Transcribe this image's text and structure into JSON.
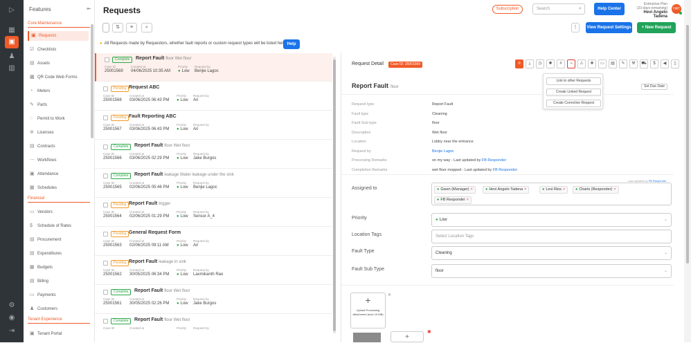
{
  "colors": {
    "accent": "#f05a28",
    "primary": "#1a73e8",
    "success": "#21a35a"
  },
  "sidebar": {
    "header": "Features",
    "collapse_icon": "collapse-icon",
    "groups": [
      {
        "label": "Core Maintenance"
      },
      {
        "label": "Financial"
      },
      {
        "label": "Tenant Experience"
      }
    ],
    "items": [
      {
        "label": "Requests"
      },
      {
        "label": "Checklists"
      },
      {
        "label": "Assets"
      },
      {
        "label": "QR Code Web Forms"
      },
      {
        "label": "Meters"
      },
      {
        "label": "Parts"
      },
      {
        "label": "Permit to Work"
      },
      {
        "label": "Licenses"
      },
      {
        "label": "Contracts"
      },
      {
        "label": "Workflows"
      },
      {
        "label": "Attendance"
      },
      {
        "label": "Schedules"
      },
      {
        "label": "Vendors"
      },
      {
        "label": "Schedule of Rates"
      },
      {
        "label": "Procurement"
      },
      {
        "label": "Expenditures"
      },
      {
        "label": "Budgets"
      },
      {
        "label": "Billing"
      },
      {
        "label": "Payments"
      },
      {
        "label": "Customers"
      },
      {
        "label": "Tenant Portal"
      }
    ]
  },
  "header": {
    "title": "Requests",
    "subscription": "Subscription",
    "search_placeholder": "Search",
    "help_center": "Help Center",
    "plan": "Enterprise Plan",
    "remaining": "(23 days remaining)",
    "user_name": "Hevi Angelo Tadena",
    "initials": "HAT"
  },
  "toolbar": {
    "view_settings": "View Request Settings",
    "new_request": "+ New Request",
    "kebab": "⋮"
  },
  "info": {
    "text": "All Requests made by Requestors, whether fault reports or custom request types will be listed here.",
    "help": "Help"
  },
  "list_labels": {
    "case": "Case ID",
    "created": "Created at",
    "priority": "Priority",
    "requested": "Request by"
  },
  "requests": [
    {
      "status": "Complete",
      "title": "Report Fault",
      "sub": "floor Wet floor",
      "case": "25001569",
      "created": "04/06/2025 10:35 AM",
      "priority": "Low",
      "by": "Benjie Lagoc"
    },
    {
      "status": "Pending",
      "title": "Request ABC",
      "sub": "",
      "case": "25001568",
      "created": "03/06/2025 06:43 PM",
      "priority": "Low",
      "by": "Ari"
    },
    {
      "status": "Pending",
      "title": "Fault Reporting ABC",
      "sub": "",
      "case": "25001567",
      "created": "03/06/2025 06:43 PM",
      "priority": "Low",
      "by": "Ari"
    },
    {
      "status": "Complete",
      "title": "Report Fault",
      "sub": "floor Wet floor",
      "case": "25001566",
      "created": "03/06/2025 02:29 PM",
      "priority": "Low",
      "by": "Jake Burgos"
    },
    {
      "status": "Complete",
      "title": "Report Fault",
      "sub": "leakage Water leakage under the sink",
      "case": "25001565",
      "created": "02/06/2025 05:46 PM",
      "priority": "Low",
      "by": "Benjie Lagoc"
    },
    {
      "status": "Pending",
      "title": "Report Fault",
      "sub": "trigger",
      "case": "25001564",
      "created": "02/06/2025 01:29 PM",
      "priority": "Low",
      "by": "Sensor A_4"
    },
    {
      "status": "Pending",
      "title": "General Request Form",
      "sub": "",
      "case": "25001563",
      "created": "02/06/2025 09:11 AM",
      "priority": "Low",
      "by": "Ari"
    },
    {
      "status": "Pending",
      "title": "Report Fault",
      "sub": "leakage in sink",
      "case": "25001562",
      "created": "30/05/2025 06:34 PM",
      "priority": "Low",
      "by": "Laxmikanth Rao"
    },
    {
      "status": "Complete",
      "title": "Report Fault",
      "sub": "floor Wet floor",
      "case": "25001561",
      "created": "30/05/2025 02:26 PM",
      "priority": "Low",
      "by": "Jake Burgos"
    },
    {
      "status": "Complete",
      "title": "Report Fault",
      "sub": "floor Wet floor",
      "case": "",
      "created": "",
      "priority": "",
      "by": ""
    }
  ],
  "detail": {
    "title": "Request Detail",
    "case_badge": "Case ID: 25001569",
    "heading": "Report Fault",
    "heading_sub": "floor",
    "set_due": "Set Due Date",
    "menu": [
      "Link to other Requests",
      "Create Linked Request",
      "Create Corrective Request"
    ],
    "fields": [
      {
        "k": "Request type",
        "v": "Report Fault",
        "link": false
      },
      {
        "k": "Fault type",
        "v": "Cleaning",
        "link": false
      },
      {
        "k": "Fault Sub-type",
        "v": "floor",
        "link": false
      },
      {
        "k": "Description",
        "v": "Wet floor",
        "link": false
      },
      {
        "k": "Location",
        "v": "Lobby near the entrance",
        "link": false
      },
      {
        "k": "Request by",
        "v": "Benjie Lagoc",
        "link": true
      },
      {
        "k": "Processing Remarks",
        "v": "on my way - Last updated by ",
        "lnk": "FB Responder"
      },
      {
        "k": "Completion Remarks",
        "v": "wet floor mopped - Last updated by ",
        "lnk": "FB Responder"
      }
    ],
    "last_updated": "Last updated by",
    "last_updated_by": "FB Responder",
    "assigned_label": "Assigned to",
    "assignees": [
      "Gwen (Manager)",
      "Hevi Angelo Tadena",
      "Levi Rios",
      "Charls (Responder)",
      "FB Responder"
    ],
    "priority_label": "Priority",
    "priority_value": "Low",
    "location_label": "Location Tags",
    "location_placeholder": "Select Location Tags",
    "fault_type_label": "Fault Type",
    "fault_type_value": "Cleaning",
    "fault_sub_label": "Fault Sub Type",
    "fault_sub_value": "floor",
    "upload_text": "Upload Processing Attachment (max 10 MB)"
  }
}
